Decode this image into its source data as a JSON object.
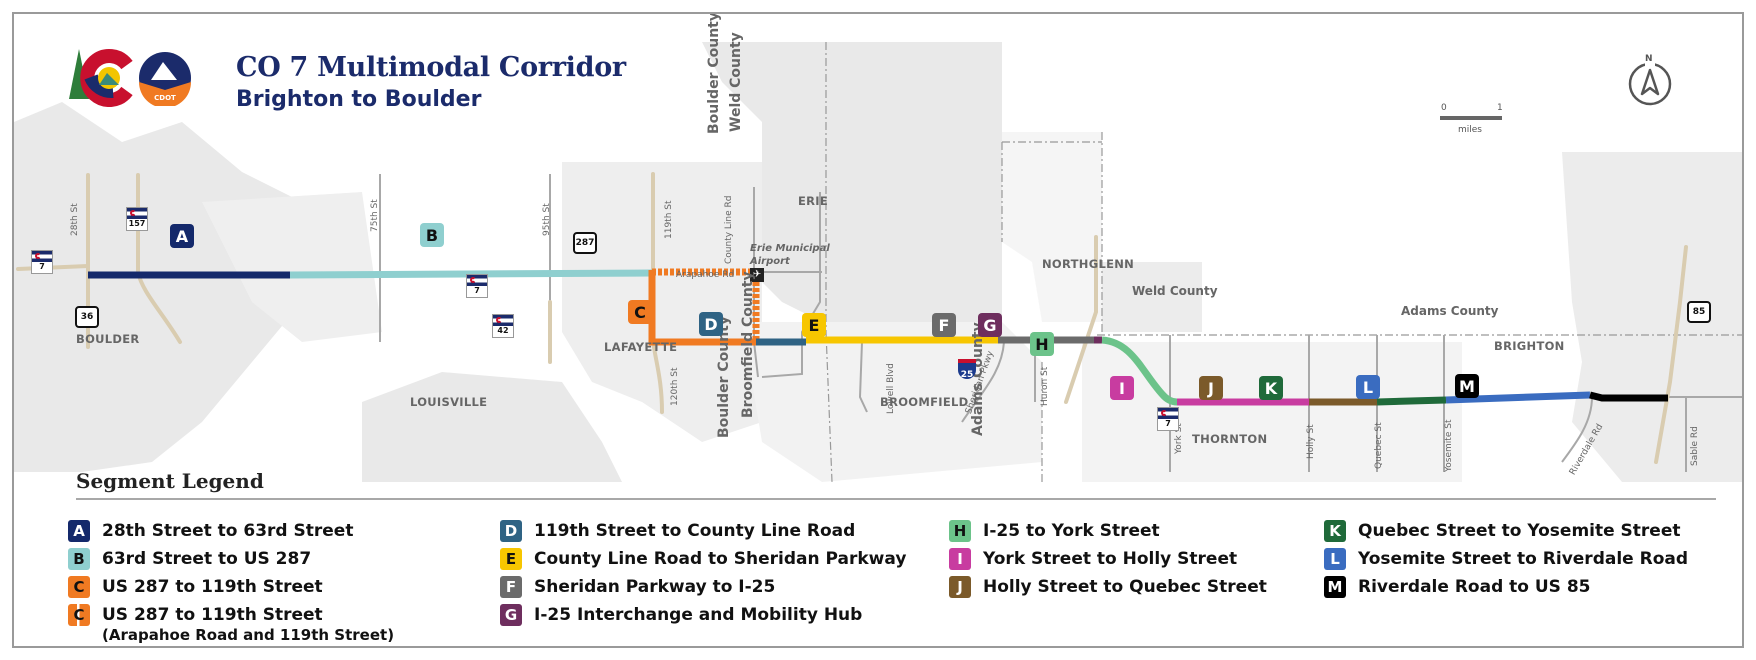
{
  "header": {
    "title": "CO 7 Multimodal Corridor",
    "subtitle": "Brighton to Boulder",
    "logos": [
      "colorado-state-logo",
      "cdot-logo"
    ],
    "cdot_label": "CDOT"
  },
  "scale": {
    "north_label": "N",
    "start": "0",
    "end": "1",
    "unit": "miles"
  },
  "places": {
    "boulder": "BOULDER",
    "louisville": "LOUISVILLE",
    "lafayette": "LAFAYETTE",
    "erie": "ERIE",
    "broomfield": "BROOMFIELD",
    "northglenn": "NORTHGLENN",
    "thornton": "THORNTON",
    "brighton": "BRIGHTON",
    "airport": "Erie Municipal",
    "airport2": "Airport"
  },
  "counties": {
    "boulder_county_n": "Boulder County",
    "weld_county_n": "Weld County",
    "boulder_county_s": "Boulder County",
    "broomfield_county": "Broomfield County",
    "adams_county_v": "Adams County",
    "weld_county_e": "Weld County",
    "adams_county_e": "Adams County"
  },
  "roads": {
    "st28": "28th St",
    "st75": "75th St",
    "st95": "95th St",
    "st119": "119th St",
    "st120": "120th St",
    "county_line": "County Line Rd",
    "arapahoe": "Arapahoe Rd",
    "lowell": "Lowell Blvd",
    "sheridan": "Sheridan Pkwy",
    "huron": "Huron St",
    "york": "York St",
    "holly": "Holly St",
    "quebec": "Quebec St",
    "yosemite": "Yosemite St",
    "riverdale": "Riverdale Rd",
    "sable": "Sable Rd"
  },
  "shields": {
    "co7_a": "7",
    "co157": "157",
    "us36": "36",
    "co7_b": "7",
    "co42": "42",
    "us287": "287",
    "i25": "25",
    "co7_c": "7",
    "us85": "85"
  },
  "legend": {
    "title": "Segment Legend",
    "items": [
      {
        "letter": "A",
        "label": "28th Street to 63rd Street",
        "color": "#14296b",
        "text_color": "#ffffff"
      },
      {
        "letter": "B",
        "label": "63rd Street to US 287",
        "color": "#8fcfcf",
        "text_color": "#111111"
      },
      {
        "letter": "C",
        "label": "US 287 to 119th Street",
        "color": "#f07a22",
        "text_color": "#111111"
      },
      {
        "letter": "C",
        "label": "US 287 to 119th Street",
        "sublabel": "(Arapahoe Road and 119th Street)",
        "color": "#f07a22",
        "text_color": "#111111",
        "dashed": true
      },
      {
        "letter": "D",
        "label": "119th Street to County Line Road",
        "color": "#2f6384",
        "text_color": "#ffffff"
      },
      {
        "letter": "E",
        "label": "County Line Road to Sheridan Parkway",
        "color": "#f7c600",
        "text_color": "#111111"
      },
      {
        "letter": "F",
        "label": "Sheridan Parkway to I-25",
        "color": "#6b6b6b",
        "text_color": "#ffffff"
      },
      {
        "letter": "G",
        "label": "I-25 Interchange and Mobility Hub",
        "color": "#6e2e5e",
        "text_color": "#ffffff"
      },
      {
        "letter": "H",
        "label": "I-25 to York Street",
        "color": "#6cc38a",
        "text_color": "#111111"
      },
      {
        "letter": "I",
        "label": "York Street to Holly Street",
        "color": "#c83ca0",
        "text_color": "#ffffff"
      },
      {
        "letter": "J",
        "label": "Holly Street to Quebec Street",
        "color": "#7b5a2a",
        "text_color": "#ffffff"
      },
      {
        "letter": "K",
        "label": "Quebec Street to Yosemite Street",
        "color": "#1f6a3a",
        "text_color": "#ffffff"
      },
      {
        "letter": "L",
        "label": "Yosemite Street to Riverdale Road",
        "color": "#3a6cc0",
        "text_color": "#ffffff"
      },
      {
        "letter": "M",
        "label": "Riverdale Road to US 85",
        "color": "#000000",
        "text_color": "#ffffff"
      }
    ]
  }
}
